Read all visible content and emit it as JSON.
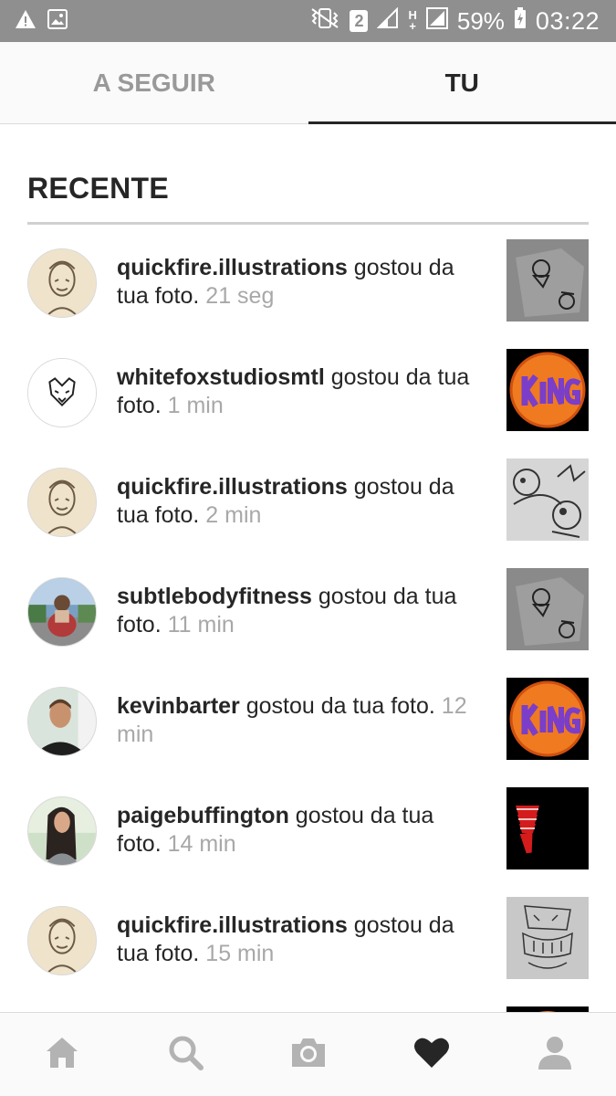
{
  "status_bar": {
    "sim_badge": "2",
    "battery_percent": "59%",
    "clock": "03:22"
  },
  "tabs": [
    {
      "label": "A SEGUIR",
      "active": false
    },
    {
      "label": "TU",
      "active": true
    }
  ],
  "section": {
    "title": "RECENTE"
  },
  "notifications": [
    {
      "user": "quickfire.illustrations",
      "action": " gostou da tua foto. ",
      "time": "21 seg",
      "avatar": "sketch-portrait",
      "thumbnail": "sketch-photo"
    },
    {
      "user": "whitefoxstudiosmtl",
      "action": " gostou da tua foto. ",
      "time": "1 min",
      "avatar": "fox-logo",
      "thumbnail": "king-logo"
    },
    {
      "user": "quickfire.illustrations",
      "action": " gostou da tua foto. ",
      "time": "2 min",
      "avatar": "sketch-portrait",
      "thumbnail": "sketch-closeup"
    },
    {
      "user": "subtlebodyfitness",
      "action": " gostou da tua foto. ",
      "time": "11 min",
      "avatar": "fitness-photo",
      "thumbnail": "sketch-photo"
    },
    {
      "user": "kevinbarter",
      "action": " gostou da tua foto. ",
      "time": "12 min",
      "avatar": "man-portrait",
      "thumbnail": "king-logo"
    },
    {
      "user": "paigebuffington",
      "action": " gostou da tua foto. ",
      "time": "14 min",
      "avatar": "woman-portrait",
      "thumbnail": "red-cups"
    },
    {
      "user": "quickfire.illustrations",
      "action": " gostou da tua foto. ",
      "time": "15 min",
      "avatar": "sketch-portrait",
      "thumbnail": "sketch-drawing"
    }
  ],
  "bottom_nav": [
    {
      "icon": "home-icon"
    },
    {
      "icon": "search-icon"
    },
    {
      "icon": "camera-icon"
    },
    {
      "icon": "heart-icon",
      "active": true
    },
    {
      "icon": "profile-icon"
    }
  ],
  "colors": {
    "status_bar": "#8f8f8f",
    "text_primary": "#262626",
    "text_secondary": "#a8a8a8",
    "tab_inactive": "#999999",
    "nav_active": "#262626",
    "nav_inactive": "#b3b3b3"
  }
}
